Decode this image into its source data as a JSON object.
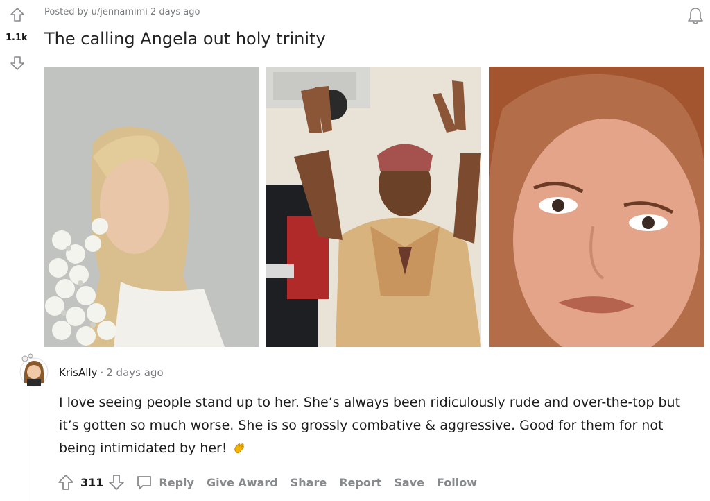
{
  "post": {
    "meta": "Posted by u/jennamimi 2 days ago",
    "score": "1.1k",
    "title": "The calling Angela out holy trinity"
  },
  "icons": {
    "upvote": "upvote-arrow-icon",
    "downvote": "downvote-arrow-icon",
    "bell": "bell-icon",
    "comment": "comment-bubble-icon",
    "clap": "clapping-hands-emoji"
  },
  "comment": {
    "username": "KrisAlly",
    "separator": "·",
    "time": "2 days ago",
    "body": "I love seeing people stand up to her. She’s always been ridiculously rude and over-the-top but it’s gotten so much worse. She is so grossly combative & aggressive. Good for them for not being intimidated by her!",
    "score": "311",
    "actions": {
      "reply": "Reply",
      "give_award": "Give Award",
      "share": "Share",
      "report": "Report",
      "save": "Save",
      "follow": "Follow"
    }
  },
  "colors": {
    "meta_gray": "#787c7e",
    "action_gray": "#878a8c",
    "text": "#1c1c1c"
  }
}
